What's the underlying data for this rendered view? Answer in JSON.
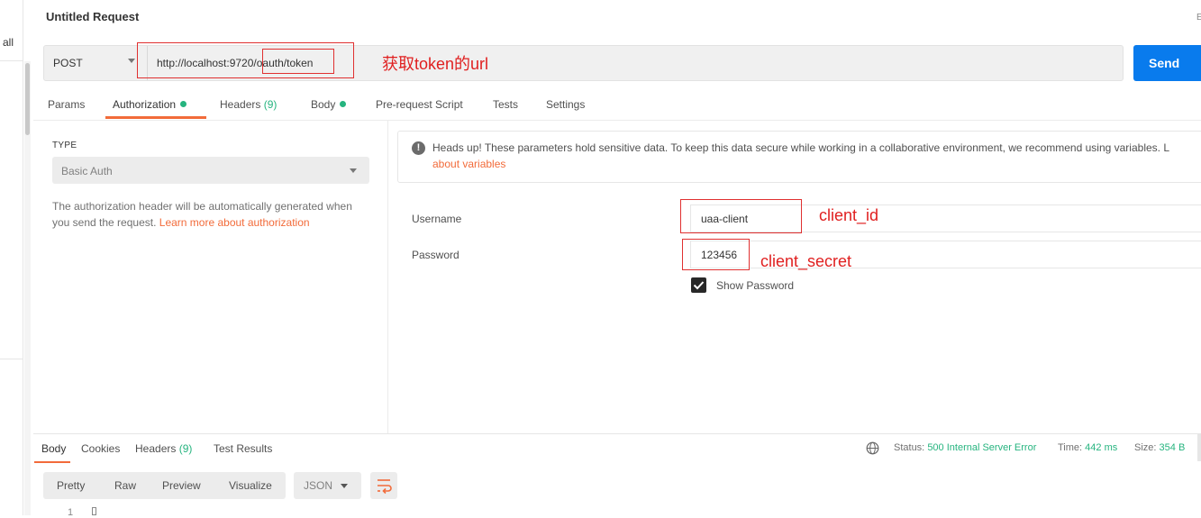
{
  "sidebar": {
    "all_label": "all"
  },
  "request": {
    "title": "Untitled Request",
    "title_right": "E",
    "method": "POST",
    "url_base": "http://localhost:9720",
    "url_path": "/oauth/token",
    "send_label": "Send",
    "annotation_url": "获取token的url"
  },
  "tabs": [
    {
      "label": "Params"
    },
    {
      "label": "Authorization"
    },
    {
      "label": "Headers",
      "count": "(9)"
    },
    {
      "label": "Body"
    },
    {
      "label": "Pre-request Script"
    },
    {
      "label": "Tests"
    },
    {
      "label": "Settings"
    }
  ],
  "auth": {
    "type_label": "TYPE",
    "type_value": "Basic Auth",
    "help_text": "The authorization header will be automatically generated when you send the request.",
    "help_link": "Learn more about authorization",
    "notice_text": "Heads up! These parameters hold sensitive data. To keep this data secure while working in a collaborative environment, we recommend using variables. L",
    "notice_link": "about variables",
    "username_label": "Username",
    "username_value": "uaa-client",
    "password_label": "Password",
    "password_value": "123456",
    "show_password_label": "Show Password",
    "show_password_checked": true,
    "annotation_client_id": "client_id",
    "annotation_client_secret": "client_secret"
  },
  "response": {
    "tabs": [
      {
        "label": "Body"
      },
      {
        "label": "Cookies"
      },
      {
        "label": "Headers",
        "count": "(9)"
      },
      {
        "label": "Test Results"
      }
    ],
    "status_label": "Status:",
    "status_value": "500 Internal Server Error",
    "time_label": "Time:",
    "time_value": "442 ms",
    "size_label": "Size:",
    "size_value": "354 B",
    "formats": [
      "Pretty",
      "Raw",
      "Preview",
      "Visualize"
    ],
    "language": "JSON",
    "line_number": "1"
  },
  "colors": {
    "accent": "#f26b3a",
    "send": "#097bed",
    "success": "#26b47f",
    "annotation": "#e02020"
  }
}
